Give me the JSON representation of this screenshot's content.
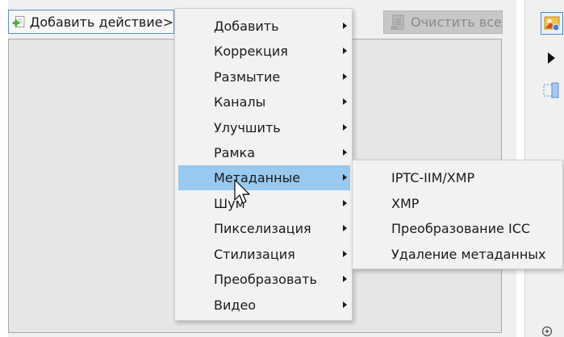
{
  "toolbar": {
    "add_action_label": "Добавить действие>",
    "clear_all_label": "Очистить все",
    "add_icon": "add-document-icon",
    "clear_icon": "clear-document-icon"
  },
  "context_menu": {
    "items": [
      {
        "label": "Добавить",
        "has_submenu": true
      },
      {
        "label": "Коррекция",
        "has_submenu": true
      },
      {
        "label": "Размытие",
        "has_submenu": true
      },
      {
        "label": "Каналы",
        "has_submenu": true
      },
      {
        "label": "Улучшить",
        "has_submenu": true
      },
      {
        "label": "Рамка",
        "has_submenu": true
      },
      {
        "label": "Метаданные",
        "has_submenu": true,
        "highlighted": true
      },
      {
        "label": "Шум",
        "has_submenu": true
      },
      {
        "label": "Пикселизация",
        "has_submenu": true
      },
      {
        "label": "Стилизация",
        "has_submenu": true
      },
      {
        "label": "Преобразовать",
        "has_submenu": true
      },
      {
        "label": "Видео",
        "has_submenu": true
      }
    ]
  },
  "submenu": {
    "parent": "Метаданные",
    "items": [
      {
        "label": "IPTC-IIM/XMP"
      },
      {
        "label": "XMP"
      },
      {
        "label": "Преобразование ICC"
      },
      {
        "label": "Удаление метаданных"
      }
    ]
  },
  "colors": {
    "highlight": "#99c9ef",
    "menu_background": "#f2f2f2",
    "button_border": "#5a8bd1",
    "disabled_button": "#c7c7c7"
  }
}
